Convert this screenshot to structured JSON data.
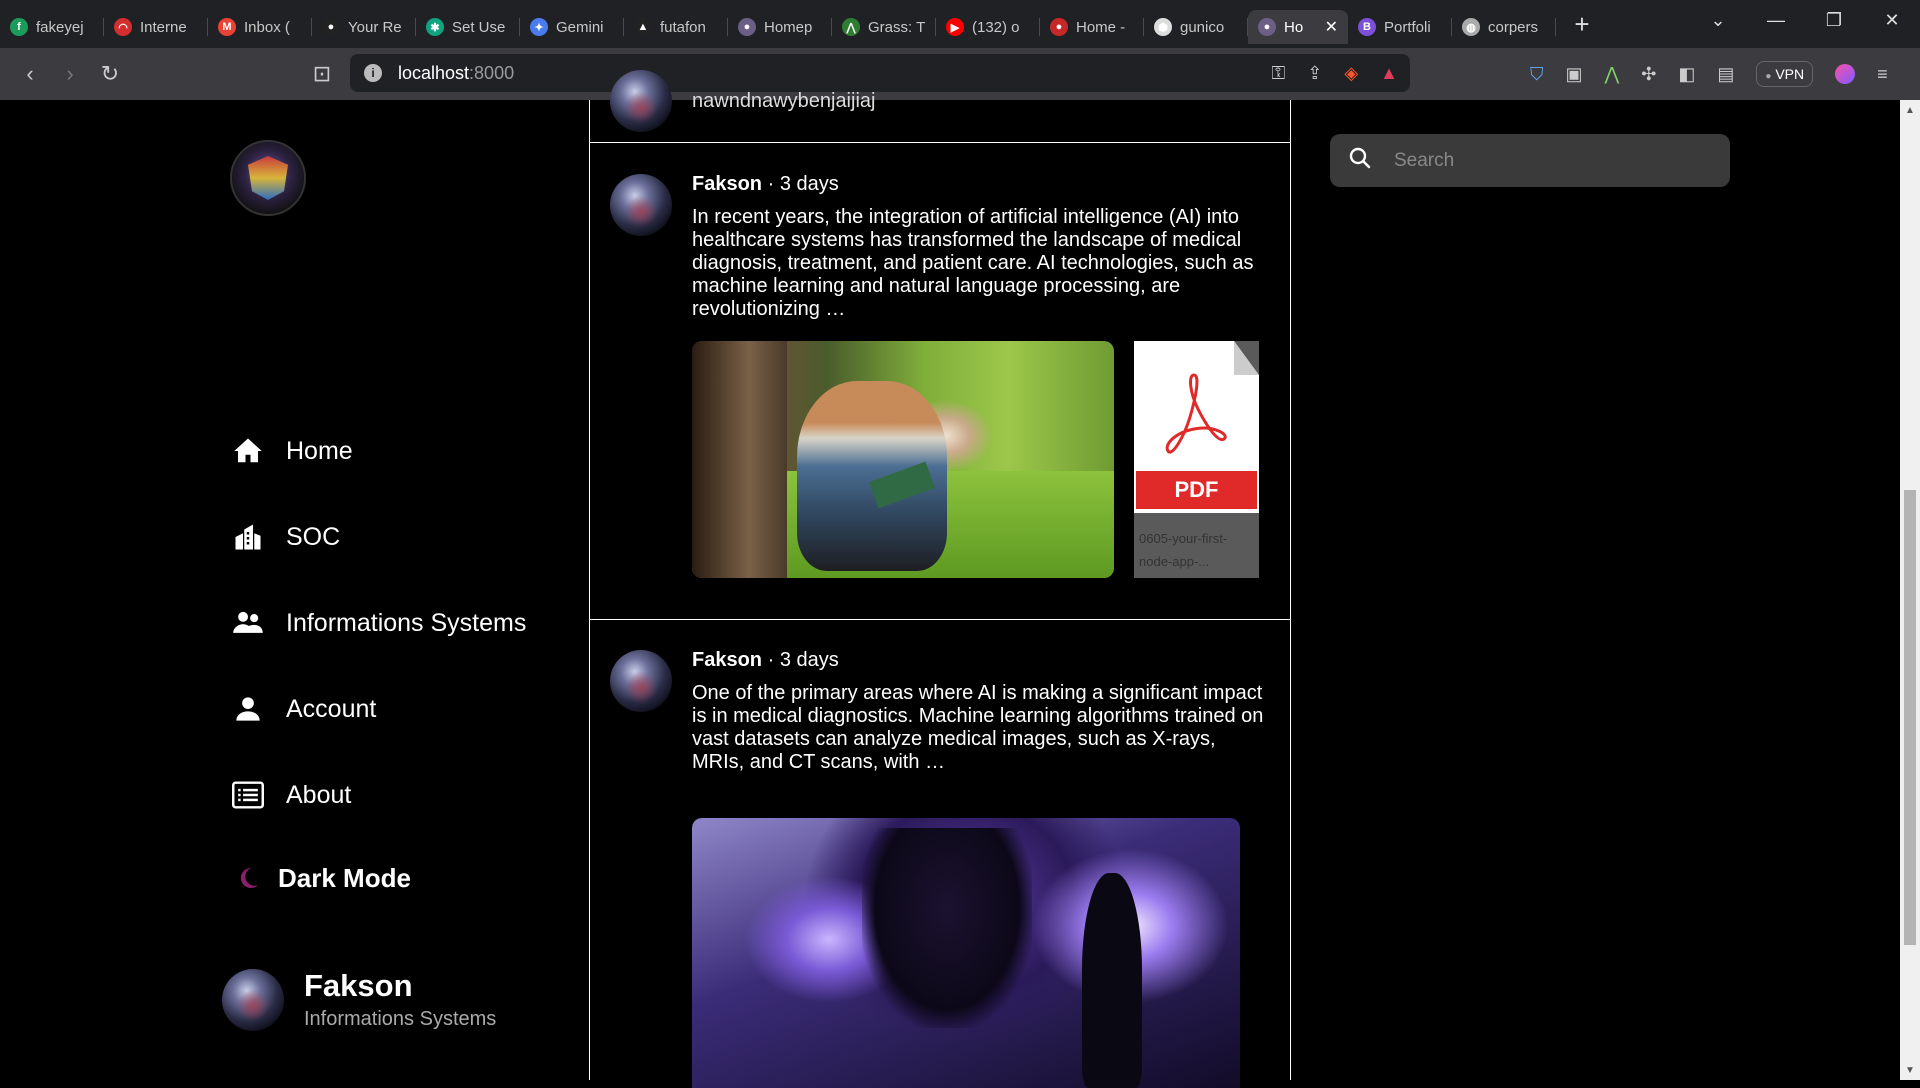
{
  "browser": {
    "tabs": [
      {
        "title": "fakeyej",
        "favicon_color": "#1a9c5b",
        "glyph": "f"
      },
      {
        "title": "Interne",
        "favicon_color": "#d32f2f",
        "glyph": "◠"
      },
      {
        "title": "Inbox (",
        "favicon_color": "#ea4335",
        "glyph": "M"
      },
      {
        "title": "Your Re",
        "favicon_color": "#222222",
        "glyph": "●"
      },
      {
        "title": "Set Use",
        "favicon_color": "#10a37f",
        "glyph": "✱"
      },
      {
        "title": "Gemini",
        "favicon_color": "#4a7cf0",
        "glyph": "✦"
      },
      {
        "title": "futafon",
        "favicon_color": "#222222",
        "glyph": "▲"
      },
      {
        "title": "Homep",
        "favicon_color": "#6b5f88",
        "glyph": "●"
      },
      {
        "title": "Grass: T",
        "favicon_color": "#2e7d32",
        "glyph": "⋀"
      },
      {
        "title": "(132) o",
        "favicon_color": "#ff0000",
        "glyph": "▶"
      },
      {
        "title": "Home -",
        "favicon_color": "#c62828",
        "glyph": "●"
      },
      {
        "title": "gunico",
        "favicon_color": "#dddddd",
        "glyph": "⬢"
      }
    ],
    "active_tab": {
      "title": "Ho",
      "favicon_color": "#6b5f88",
      "glyph": "●",
      "close": "✕"
    },
    "tabs_after": [
      {
        "title": "Portfoli",
        "favicon_color": "#7b4fd6",
        "glyph": "B"
      },
      {
        "title": "corpers",
        "favicon_color": "#aaaaaa",
        "glyph": "◍"
      }
    ],
    "new_tab": "+",
    "window_controls": {
      "dropdown": "⌄",
      "minimize": "—",
      "restore": "❐",
      "close": "✕"
    },
    "nav": {
      "back": "‹",
      "forward": "›",
      "reload": "↻",
      "bookmark": "⊡"
    },
    "url_host": "localhost",
    "url_port": ":8000",
    "info_glyph": "i",
    "url_icons": {
      "key": "⚿",
      "share": "⇪",
      "brave": "◈",
      "rewards": "▲"
    },
    "extensions": {
      "shield": "⛉",
      "ext1": "▣",
      "ext2": "⋀",
      "puzzle": "✣",
      "sidebar": "◧",
      "wallet": "▤",
      "vpn": "VPN",
      "vpn_dot": "●",
      "menu": "≡"
    }
  },
  "sidebar": {
    "nav": [
      {
        "label": "Home",
        "icon": "home-icon"
      },
      {
        "label": "SOC",
        "icon": "building-icon"
      },
      {
        "label": "Informations Systems",
        "icon": "users-icon"
      },
      {
        "label": "Account",
        "icon": "user-icon"
      },
      {
        "label": "About",
        "icon": "list-icon"
      }
    ],
    "dark_mode": {
      "label": "Dark Mode",
      "icon": "moon-icon",
      "color": "#8a1f6b"
    },
    "profile": {
      "name": "Fakson",
      "role": "Informations Systems"
    }
  },
  "feed": {
    "top_stub_text": "nawndnawybenjaijiaj",
    "posts": [
      {
        "author": "Fakson",
        "separator": "·",
        "time": "3 days",
        "text": "In recent years, the integration of artificial intelligence (AI) into healthcare systems has transformed the landscape of medical diagnosis, treatment, and patient care. AI technologies, such as machine learning and natural language processing, are revolutionizing …",
        "attachment": {
          "type_label": "PDF",
          "filename": "0605-your-first-node-app-..."
        }
      },
      {
        "author": "Fakson",
        "separator": "·",
        "time": "3 days",
        "text": "One of the primary areas where AI is making a significant impact is in medical diagnostics. Machine learning algorithms trained on vast datasets can analyze medical images, such as X-rays, MRIs, and CT scans, with …"
      }
    ]
  },
  "search": {
    "placeholder": "Search"
  },
  "colors": {
    "background": "#000000",
    "search_bg": "#3a3a3a",
    "pdf_red": "#e02a2a",
    "chrome_dark": "#202124",
    "chrome_mid": "#3c3c40"
  }
}
